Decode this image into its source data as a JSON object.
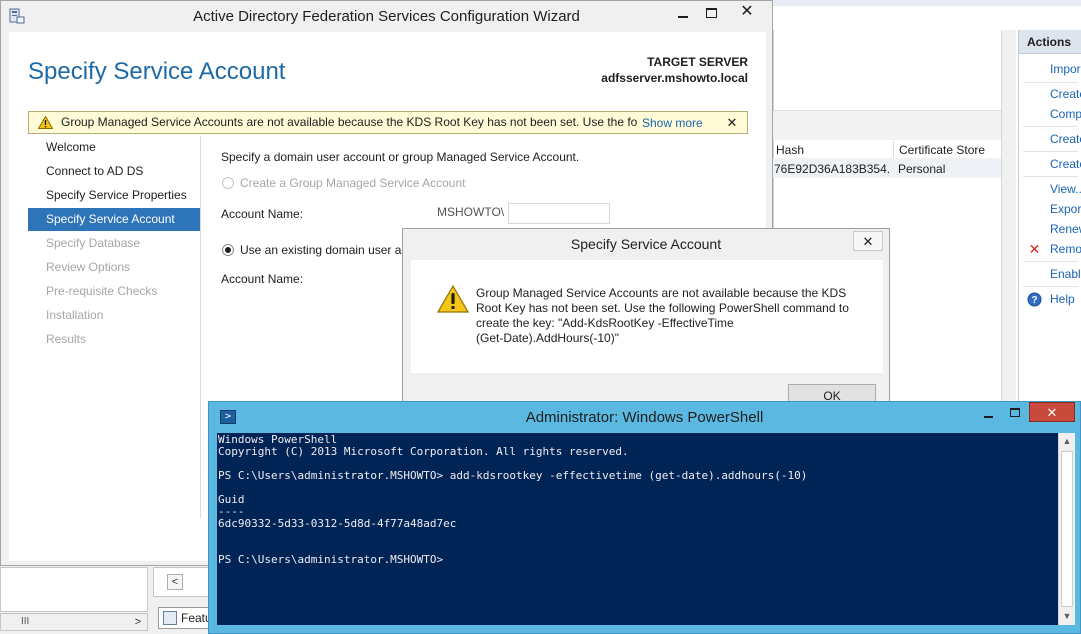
{
  "server_manager": {
    "grid_columns": [
      "Hash",
      "Certificate Store"
    ],
    "grid_row": [
      "76E92D36A183B354...",
      "Personal"
    ],
    "actions_title": "Actions",
    "actions": [
      "Impor",
      "Create",
      "Comp",
      "Create",
      "Create",
      "View...",
      "Export",
      "Renew",
      "Remo",
      "Enable",
      "Help"
    ],
    "bottom_tab_label": "Featu",
    "scroll_glyph": "III"
  },
  "wizard": {
    "title": "Active Directory Federation Services Configuration Wizard",
    "heading": "Specify Service Account",
    "target_server_label": "TARGET SERVER",
    "target_server_value": "adfsserver.mshowto.local",
    "warning_text": "Group Managed Service Accounts are not available because the KDS Root Key has not been set. Use the foll...",
    "warning_more": "Show more",
    "nav": [
      {
        "label": "Welcome",
        "state": "normal"
      },
      {
        "label": "Connect to AD DS",
        "state": "normal"
      },
      {
        "label": "Specify Service Properties",
        "state": "normal"
      },
      {
        "label": "Specify Service Account",
        "state": "active"
      },
      {
        "label": "Specify Database",
        "state": "disabled"
      },
      {
        "label": "Review Options",
        "state": "disabled"
      },
      {
        "label": "Pre-requisite Checks",
        "state": "disabled"
      },
      {
        "label": "Installation",
        "state": "disabled"
      },
      {
        "label": "Results",
        "state": "disabled"
      }
    ],
    "instruction": "Specify a domain user account or group Managed Service Account.",
    "option_gmsa": "Create a Group Managed Service Account",
    "account_name_label": "Account Name:",
    "domain_prefix": "MSHOWTO\\",
    "account_name_value": "",
    "option_existing": "Use an existing domain user ac",
    "account_name_label_2": "Account Name:"
  },
  "dialog": {
    "title": "Specify Service Account",
    "message_lines": [
      "Group Managed Service Accounts are not available because the KDS",
      "Root Key has not been set. Use the following PowerShell command to",
      "create the key: \"Add-KdsRootKey -EffectiveTime",
      "(Get-Date).AddHours(-10)\""
    ],
    "ok_label": "OK"
  },
  "powershell": {
    "title": "Administrator: Windows PowerShell",
    "lines": [
      "Windows PowerShell",
      "Copyright (C) 2013 Microsoft Corporation. All rights reserved.",
      "",
      "PS C:\\Users\\administrator.MSHOWTO> add-kdsrootkey -effectivetime (get-date).addhours(-10)",
      "",
      "Guid",
      "----",
      "6dc90332-5d33-0312-5d8d-4f77a48ad7ec",
      "",
      "",
      "PS C:\\Users\\administrator.MSHOWTO>"
    ]
  },
  "colors": {
    "accent_blue": "#2e74b9",
    "heading_blue": "#1e6aa6",
    "warning_bg": "#fffbd6",
    "powershell_bg": "#012456",
    "powershell_frame": "#5bb9e1",
    "close_red": "#c74a3a"
  },
  "icons": {
    "wizard_app": "server-role-icon",
    "warning": "warning-triangle-icon",
    "remove": "red-x-icon",
    "help": "help-circle-icon",
    "powershell": "powershell-icon"
  }
}
